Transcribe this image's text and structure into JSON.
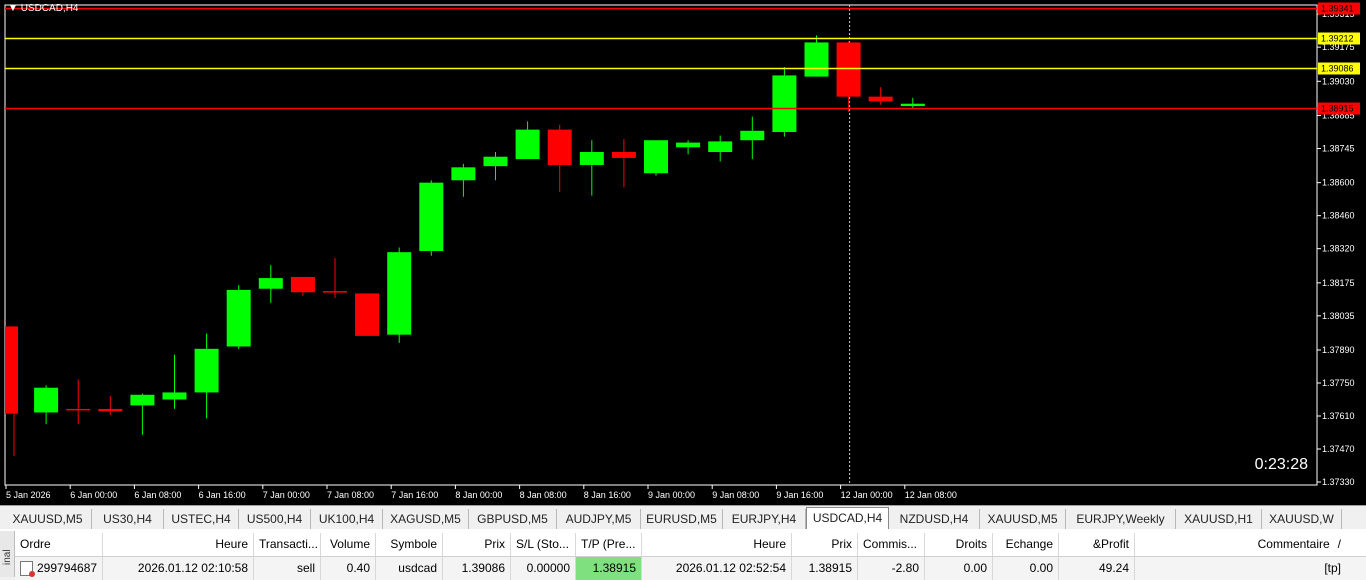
{
  "chart": {
    "symbol_title": "USDCAD,H4",
    "timer": "0:23:28",
    "price_axis": {
      "min": 1.3733,
      "max": 1.39341,
      "ticks": [
        "1.39315",
        "1.39175",
        "1.39030",
        "1.38885",
        "1.38745",
        "1.38600",
        "1.38460",
        "1.38320",
        "1.38175",
        "1.38035",
        "1.37890",
        "1.37750",
        "1.37610",
        "1.37470",
        "1.37330"
      ]
    },
    "time_labels": [
      "5 Jan 2026",
      "6 Jan 00:00",
      "6 Jan 08:00",
      "6 Jan 16:00",
      "7 Jan 00:00",
      "7 Jan 08:00",
      "7 Jan 16:00",
      "8 Jan 00:00",
      "8 Jan 08:00",
      "8 Jan 16:00",
      "9 Jan 00:00",
      "9 Jan 08:00",
      "9 Jan 16:00",
      "12 Jan 00:00",
      "12 Jan 08:00"
    ],
    "levels": [
      {
        "price": 1.39341,
        "label": "1.39341",
        "color": "#ff0000",
        "label_bg": "#ff0000",
        "label_fg": "#000000"
      },
      {
        "price": 1.39212,
        "label": "1.39212",
        "color": "#ffff00",
        "label_bg": "#ffff00",
        "label_fg": "#000000"
      },
      {
        "price": 1.39086,
        "label": "1.39086",
        "color": "#ffff00",
        "label_bg": "#ffff00",
        "label_fg": "#000000"
      },
      {
        "price": 1.38915,
        "label": "1.38915",
        "color": "#ff0000",
        "label_bg": "#ff0000",
        "label_fg": "#000000"
      }
    ],
    "colors": {
      "bull": "#00ff00",
      "bear": "#ff0000",
      "background": "#000000",
      "axis_text": "#ffffff"
    }
  },
  "chart_data": {
    "type": "candlestick",
    "title": "USDCAD,H4",
    "ylim": [
      1.3733,
      1.39341
    ],
    "candles": [
      {
        "x": 0,
        "open": 1.3799,
        "high": 1.3799,
        "low": 1.3744,
        "close": 1.3762
      },
      {
        "x": 1,
        "open": 1.37625,
        "high": 1.3774,
        "low": 1.37575,
        "close": 1.3773
      },
      {
        "x": 2,
        "open": 1.3764,
        "high": 1.37765,
        "low": 1.37575,
        "close": 1.37635
      },
      {
        "x": 3,
        "open": 1.3764,
        "high": 1.37695,
        "low": 1.37615,
        "close": 1.3763
      },
      {
        "x": 4,
        "open": 1.37655,
        "high": 1.37705,
        "low": 1.3753,
        "close": 1.377
      },
      {
        "x": 5,
        "open": 1.3768,
        "high": 1.3787,
        "low": 1.3764,
        "close": 1.3771
      },
      {
        "x": 6,
        "open": 1.3771,
        "high": 1.3796,
        "low": 1.376,
        "close": 1.37895
      },
      {
        "x": 7,
        "open": 1.37905,
        "high": 1.38165,
        "low": 1.37895,
        "close": 1.38145
      },
      {
        "x": 8,
        "open": 1.3815,
        "high": 1.3825,
        "low": 1.3809,
        "close": 1.38195
      },
      {
        "x": 9,
        "open": 1.382,
        "high": 1.382,
        "low": 1.3812,
        "close": 1.38135
      },
      {
        "x": 10,
        "open": 1.3814,
        "high": 1.3828,
        "low": 1.3811,
        "close": 1.38135
      },
      {
        "x": 11,
        "open": 1.3813,
        "high": 1.3813,
        "low": 1.3796,
        "close": 1.3795
      },
      {
        "x": 12,
        "open": 1.37955,
        "high": 1.38325,
        "low": 1.3792,
        "close": 1.38305
      },
      {
        "x": 13,
        "open": 1.3831,
        "high": 1.3861,
        "low": 1.3829,
        "close": 1.386
      },
      {
        "x": 14,
        "open": 1.3861,
        "high": 1.3868,
        "low": 1.3854,
        "close": 1.38665
      },
      {
        "x": 15,
        "open": 1.3867,
        "high": 1.3873,
        "low": 1.3861,
        "close": 1.3871
      },
      {
        "x": 16,
        "open": 1.387,
        "high": 1.3886,
        "low": 1.387,
        "close": 1.38825
      },
      {
        "x": 17,
        "open": 1.38825,
        "high": 1.38845,
        "low": 1.3856,
        "close": 1.38675
      },
      {
        "x": 18,
        "open": 1.38675,
        "high": 1.3878,
        "low": 1.38545,
        "close": 1.3873
      },
      {
        "x": 19,
        "open": 1.3873,
        "high": 1.38785,
        "low": 1.3858,
        "close": 1.38705
      },
      {
        "x": 20,
        "open": 1.3864,
        "high": 1.38765,
        "low": 1.3863,
        "close": 1.3878
      },
      {
        "x": 21,
        "open": 1.3875,
        "high": 1.3878,
        "low": 1.3872,
        "close": 1.3877
      },
      {
        "x": 22,
        "open": 1.3873,
        "high": 1.388,
        "low": 1.3869,
        "close": 1.38775
      },
      {
        "x": 23,
        "open": 1.3878,
        "high": 1.3888,
        "low": 1.387,
        "close": 1.3882
      },
      {
        "x": 24,
        "open": 1.38815,
        "high": 1.3909,
        "low": 1.38795,
        "close": 1.39055
      },
      {
        "x": 25,
        "open": 1.3905,
        "high": 1.39225,
        "low": 1.3905,
        "close": 1.39195
      },
      {
        "x": 26,
        "open": 1.39195,
        "high": 1.392,
        "low": 1.389,
        "close": 1.38965
      },
      {
        "x": 27,
        "open": 1.38965,
        "high": 1.39005,
        "low": 1.3893,
        "close": 1.38945
      },
      {
        "x": 28,
        "open": 1.38925,
        "high": 1.3896,
        "low": 1.38915,
        "close": 1.38935
      }
    ]
  },
  "tabs": [
    {
      "label": "XAUUSD,M5",
      "active": false
    },
    {
      "label": "US30,H4",
      "active": false
    },
    {
      "label": "USTEC,H4",
      "active": false
    },
    {
      "label": "US500,H4",
      "active": false
    },
    {
      "label": "UK100,H4",
      "active": false
    },
    {
      "label": "XAGUSD,M5",
      "active": false
    },
    {
      "label": "GBPUSD,M5",
      "active": false
    },
    {
      "label": "AUDJPY,M5",
      "active": false
    },
    {
      "label": "EURUSD,M5",
      "active": false
    },
    {
      "label": "EURJPY,H4",
      "active": false
    },
    {
      "label": "USDCAD,H4",
      "active": true
    },
    {
      "label": "NZDUSD,H4",
      "active": false
    },
    {
      "label": "XAUUSD,M5",
      "active": false
    },
    {
      "label": "EURJPY,Weekly",
      "active": false
    },
    {
      "label": "XAUUSD,H1",
      "active": false
    },
    {
      "label": "XAUUSD,W",
      "active": false
    }
  ],
  "terminal": {
    "side_label": "inal",
    "columns": [
      "Ordre",
      "Heure",
      "Transacti...",
      "Volume",
      "Symbole",
      "Prix",
      "S/L (Sto...",
      "T/P (Pre...",
      "Heure",
      "Prix",
      "Commis...",
      "Droits",
      "Echange",
      "&Profit",
      "Commentaire"
    ],
    "sort_indicator": "/",
    "row": {
      "ordre": "299794687",
      "heure": "2026.01.12 02:10:58",
      "transaction": "sell",
      "volume": "0.40",
      "symbole": "usdcad",
      "prix": "1.39086",
      "sl": "0.00000",
      "tp": "1.38915",
      "heure2": "2026.01.12 02:52:54",
      "prix2": "1.38915",
      "commission": "-2.80",
      "droits": "0.00",
      "echange": "0.00",
      "profit": "49.24",
      "commentaire": "[tp]"
    }
  }
}
